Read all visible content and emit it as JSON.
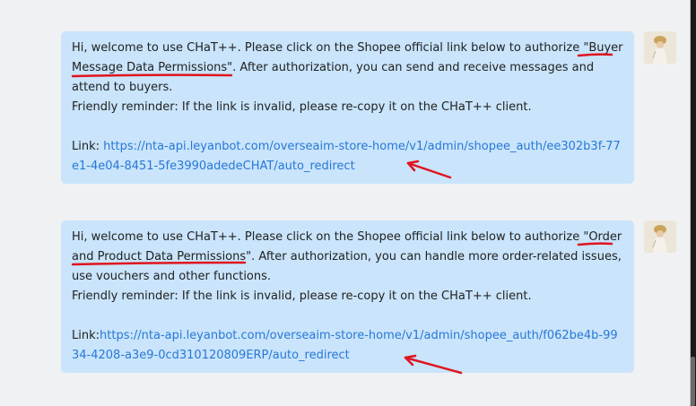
{
  "messages": [
    {
      "line1_pre": "Hi, welcome to use CHaT++. Please click on the Shopee official link below to authorize \"",
      "highlight": "Buyer Message Data Permissions",
      "line1_post": "\". After authorization, you can send and receive messages and attend to buyers.",
      "reminder": "Friendly reminder: If the link is invalid, please re-copy it on the CHaT++ client.",
      "link_label": "Link: ",
      "link_url": "https://nta-api.leyanbot.com/overseaim-store-home/v1/admin/shopee_auth/ee302b3f-77e1-4e04-8451-5fe3990adedeCHAT/auto_redirect"
    },
    {
      "line1_pre": "Hi, welcome to use CHaT++. Please click on the Shopee official link below to authorize \"",
      "highlight": "Order and Product Data Permissions",
      "line1_post": "\". After authorization, you can handle more order-related issues, use vouchers and other functions.",
      "reminder": "Friendly reminder: If the link is invalid, please re-copy it on the CHaT++ client.",
      "link_label": "Link:",
      "link_url": "https://nta-api.leyanbot.com/overseaim-store-home/v1/admin/shopee_auth/f062be4b-9934-4208-a3e9-0cd310120809ERP/auto_redirect"
    }
  ],
  "colors": {
    "bubble": "#c9e4fb",
    "link": "#2878d6",
    "annotation": "#e0141e",
    "background": "#f0f1f3"
  },
  "icons": {
    "avatar": "user-avatar-icon",
    "arrow": "annotation-arrow-icon"
  }
}
